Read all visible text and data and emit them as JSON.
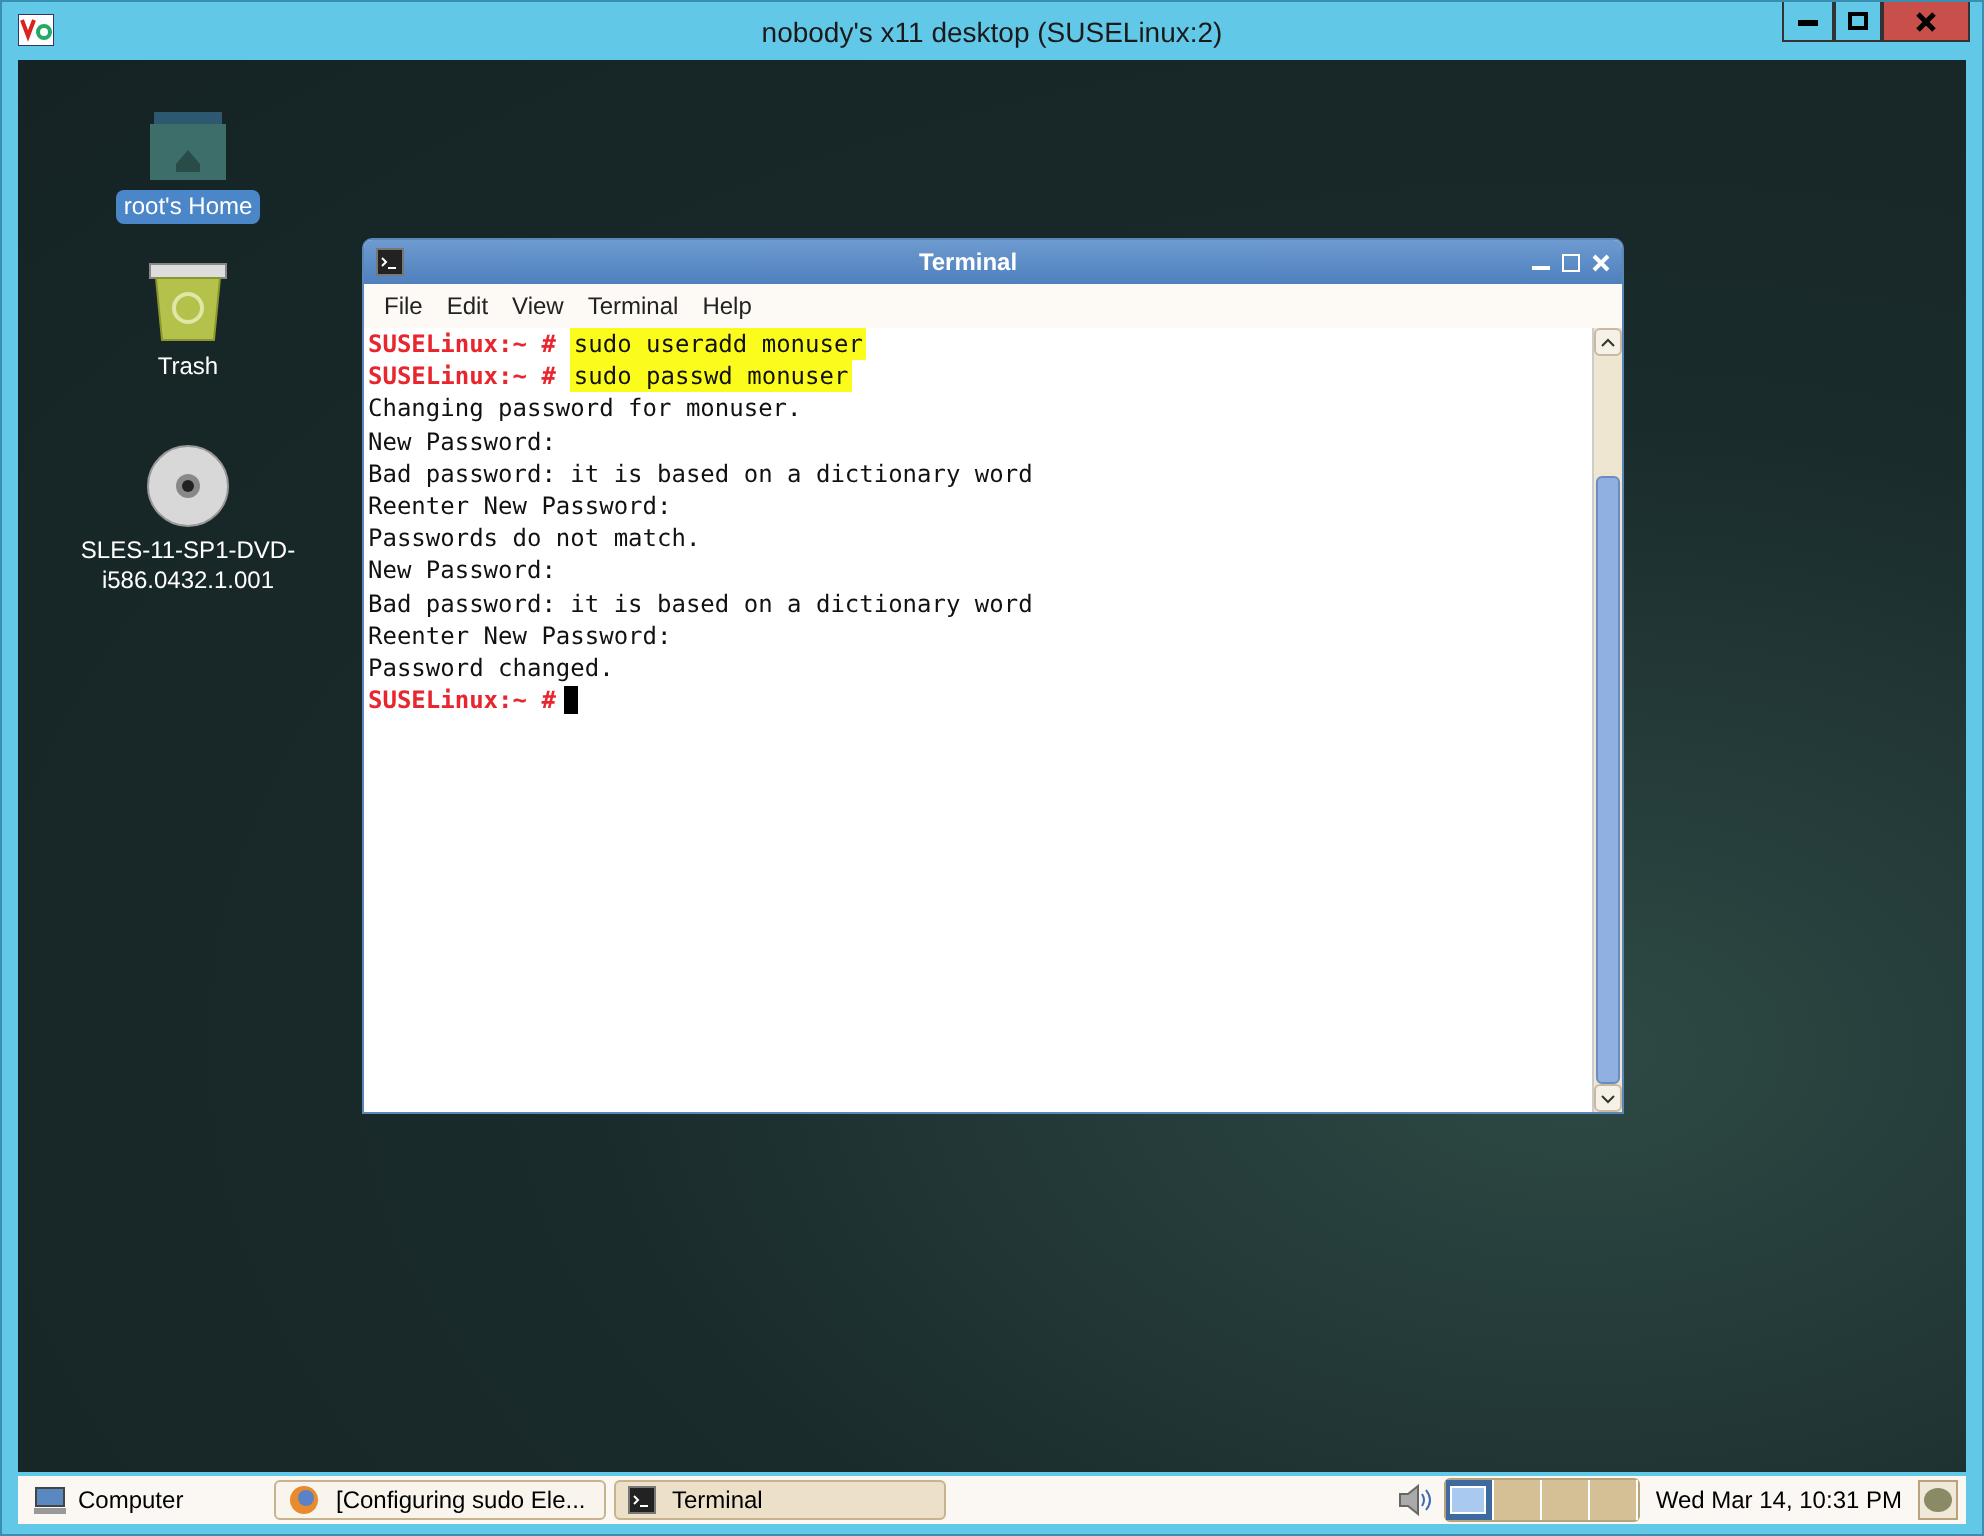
{
  "window": {
    "title": "nobody's x11 desktop (SUSELinux:2)"
  },
  "desktop_icons": [
    {
      "kind": "folder",
      "label": "root's Home",
      "selected": true
    },
    {
      "kind": "trash",
      "label": "Trash",
      "selected": false
    },
    {
      "kind": "disc",
      "label": "SLES-11-SP1-DVD-i586.0432.1.001",
      "selected": false
    }
  ],
  "terminal": {
    "title": "Terminal",
    "menu": [
      "File",
      "Edit",
      "View",
      "Terminal",
      "Help"
    ],
    "lines": [
      {
        "kind": "prompt",
        "prompt": "SUSELinux:~ #",
        "command": "sudo useradd monuser",
        "highlighted": true
      },
      {
        "kind": "prompt",
        "prompt": "SUSELinux:~ #",
        "command": "sudo passwd monuser",
        "highlighted": true
      },
      {
        "kind": "output",
        "text": "Changing password for monuser."
      },
      {
        "kind": "output",
        "text": "New Password:"
      },
      {
        "kind": "output",
        "text": "Bad password: it is based on a dictionary word"
      },
      {
        "kind": "output",
        "text": "Reenter New Password:"
      },
      {
        "kind": "output",
        "text": "Passwords do not match."
      },
      {
        "kind": "output",
        "text": "New Password:"
      },
      {
        "kind": "output",
        "text": "Bad password: it is based on a dictionary word"
      },
      {
        "kind": "output",
        "text": "Reenter New Password:"
      },
      {
        "kind": "output",
        "text": "Password changed."
      },
      {
        "kind": "prompt",
        "prompt": "SUSELinux:~ #",
        "cursor": true
      }
    ]
  },
  "taskbar": {
    "menu": "Computer",
    "tasks": [
      {
        "kind": "browser",
        "label": "[Configuring sudo Ele...",
        "selected": false
      },
      {
        "kind": "terminal",
        "label": "Terminal",
        "selected": true
      }
    ],
    "workspaces": [
      {
        "selected": true
      },
      {
        "selected": false
      },
      {
        "selected": false
      },
      {
        "selected": false
      }
    ],
    "clock": "Wed Mar 14, 10:31 PM"
  }
}
